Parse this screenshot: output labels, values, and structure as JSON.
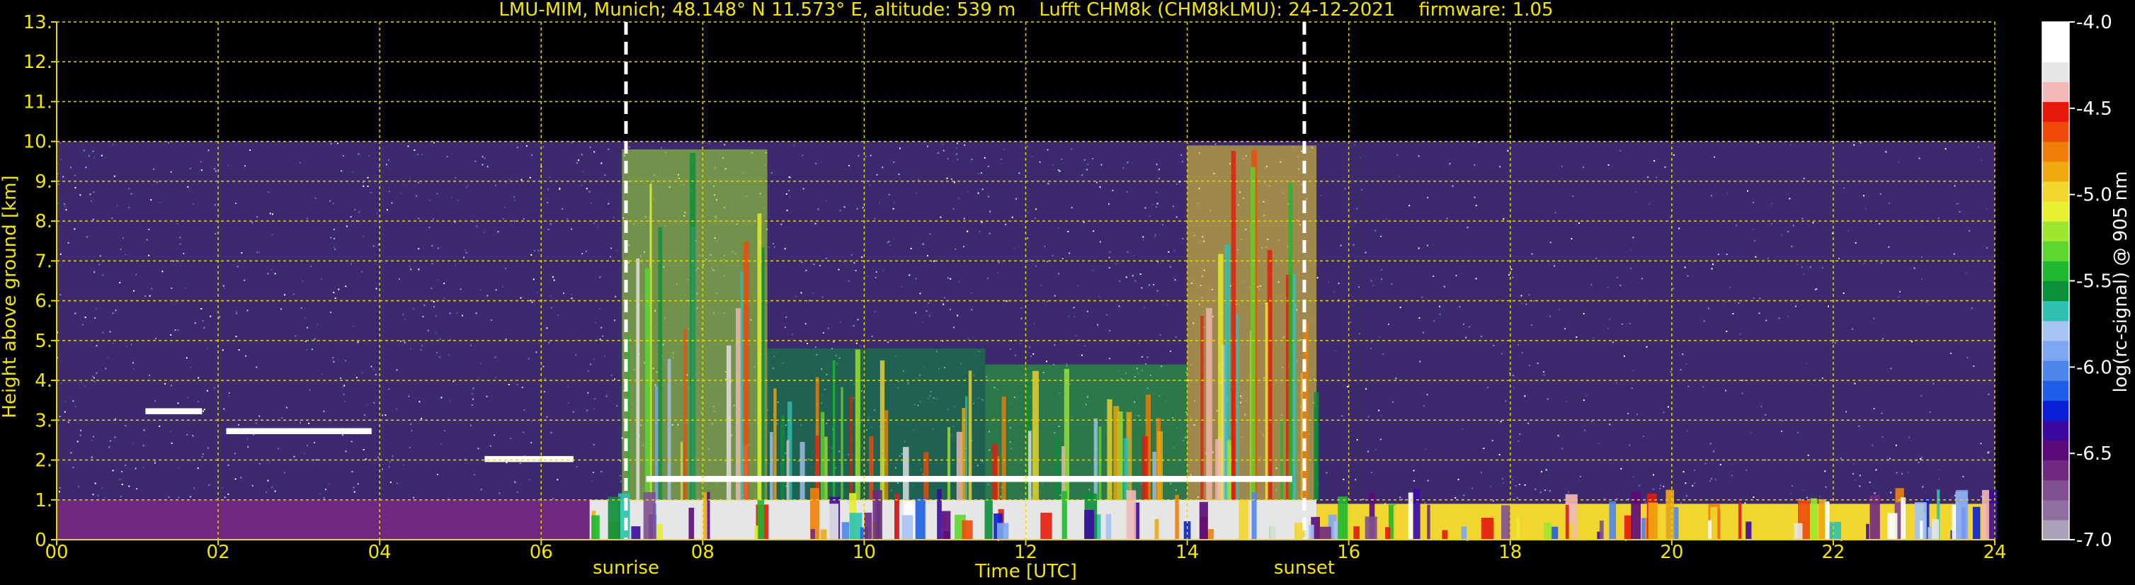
{
  "chart_data": {
    "type": "heatmap",
    "title": "LMU-MIM, Munich; 48.148° N 11.573° E, altitude: 539 m    Lufft CHM8k (CHM8kLMU): 24-12-2021    firmware: 1.05",
    "xlabel": "Time [UTC]",
    "ylabel": "Height above ground [km]",
    "xlim": [
      0,
      24
    ],
    "ylim": [
      0,
      13
    ],
    "x_ticks": [
      {
        "v": 0,
        "label": "00"
      },
      {
        "v": 2,
        "label": "02"
      },
      {
        "v": 4,
        "label": "04"
      },
      {
        "v": 6,
        "label": "06"
      },
      {
        "v": 8,
        "label": "08"
      },
      {
        "v": 10,
        "label": "10"
      },
      {
        "v": 12,
        "label": "12"
      },
      {
        "v": 14,
        "label": "14"
      },
      {
        "v": 16,
        "label": "16"
      },
      {
        "v": 18,
        "label": "18"
      },
      {
        "v": 20,
        "label": "20"
      },
      {
        "v": 22,
        "label": "22"
      },
      {
        "v": 24,
        "label": "24"
      }
    ],
    "y_ticks": [
      {
        "v": 0,
        "label": "0."
      },
      {
        "v": 1,
        "label": "1."
      },
      {
        "v": 2,
        "label": "2."
      },
      {
        "v": 3,
        "label": "3."
      },
      {
        "v": 4,
        "label": "4."
      },
      {
        "v": 5,
        "label": "5."
      },
      {
        "v": 6,
        "label": "6."
      },
      {
        "v": 7,
        "label": "7."
      },
      {
        "v": 8,
        "label": "8."
      },
      {
        "v": 9,
        "label": "9."
      },
      {
        "v": 10,
        "label": "10."
      },
      {
        "v": 11,
        "label": "11."
      },
      {
        "v": 12,
        "label": "12."
      },
      {
        "v": 13,
        "label": "13."
      }
    ],
    "grid": true,
    "measurement_top_km": 10,
    "events": [
      {
        "label": "sunrise",
        "x": 7.05
      },
      {
        "label": "sunset",
        "x": 15.45
      }
    ],
    "colorbar": {
      "label": "log(rc-signal) @ 905 nm",
      "range": [
        -7.0,
        -4.0
      ],
      "ticks": [
        {
          "v": -4.0,
          "label": "-4.0"
        },
        {
          "v": -4.5,
          "label": "-4.5"
        },
        {
          "v": -5.0,
          "label": "-5.0"
        },
        {
          "v": -5.5,
          "label": "-5.5"
        },
        {
          "v": -6.0,
          "label": "-6.0"
        },
        {
          "v": -6.5,
          "label": "-6.5"
        },
        {
          "v": -7.0,
          "label": "-7.0"
        }
      ],
      "colors": [
        "#a9a0b7",
        "#8f6f9f",
        "#7f4f8f",
        "#6f2a7f",
        "#5b0a7a",
        "#3a0aa0",
        "#0a1fd6",
        "#1f5fe6",
        "#4f86ee",
        "#7fa6f0",
        "#a5c2f2",
        "#2fc2b0",
        "#0a8f3a",
        "#1fb82f",
        "#5fd62f",
        "#9fe62f",
        "#e6f02f",
        "#f0d62f",
        "#f0a80f",
        "#f07f0a",
        "#f04a0a",
        "#e61a0a",
        "#f2b8b8",
        "#e6e6e6",
        "#ffffff",
        "#ffffff"
      ]
    },
    "profile_layers": [
      {
        "start": 0.0,
        "end": 6.6,
        "top": 1.0,
        "value": -6.6
      },
      {
        "start": 6.6,
        "end": 15.6,
        "top": 1.0,
        "value": -4.3
      },
      {
        "start": 15.6,
        "end": 24.0,
        "top": 0.9,
        "value": -5.0
      }
    ],
    "plume_regions": [
      {
        "start": 7.0,
        "end": 8.8,
        "top": 9.8,
        "value": -5.2
      },
      {
        "start": 8.8,
        "end": 11.5,
        "top": 4.8,
        "value": -5.6
      },
      {
        "start": 11.5,
        "end": 14.0,
        "top": 4.4,
        "value": -5.5
      },
      {
        "start": 14.0,
        "end": 15.6,
        "top": 9.9,
        "value": -5.0
      }
    ],
    "cloud_layers": [
      {
        "start": 1.1,
        "end": 1.8,
        "base": 3.15,
        "value": -4.0
      },
      {
        "start": 2.1,
        "end": 3.9,
        "base": 2.65,
        "value": -4.0
      },
      {
        "start": 5.3,
        "end": 6.4,
        "base": 1.95,
        "value": -4.0
      },
      {
        "start": 7.3,
        "end": 15.3,
        "base": 1.45,
        "value": -4.2
      }
    ]
  }
}
